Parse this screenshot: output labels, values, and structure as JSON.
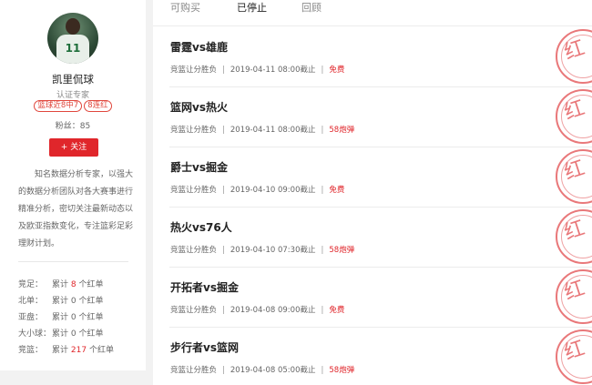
{
  "profile": {
    "avatar_number": "11",
    "name": "凯里侃球",
    "certification": "认证专家",
    "tags": [
      "篮球近8中7",
      "8连红"
    ],
    "fans_label": "粉丝：",
    "fans_count": "85",
    "follow_button": "+ 关注",
    "bio": "知名数据分析专家，以强大的数据分析团队对各大赛事进行精准分析，密切关注最新动态以及欧亚指数变化，专注篮彩足彩理财计划。",
    "stats": [
      {
        "label": "竞足：",
        "prefix": "累计",
        "count": "8",
        "suffix": "个红单",
        "highlight": true
      },
      {
        "label": "北单：",
        "prefix": "累计",
        "count": "0",
        "suffix": "个红单",
        "highlight": false
      },
      {
        "label": "亚盘：",
        "prefix": "累计",
        "count": "0",
        "suffix": "个红单",
        "highlight": false
      },
      {
        "label": "大小球：",
        "prefix": "累计",
        "count": "0",
        "suffix": "个红单",
        "highlight": false
      },
      {
        "label": "竞篮：",
        "prefix": "累计",
        "count": "217",
        "suffix": "个红单",
        "highlight": true
      }
    ]
  },
  "tabs": [
    {
      "label": "可购买",
      "active": false
    },
    {
      "label": "已停止",
      "active": true
    },
    {
      "label": "回顾",
      "active": false
    }
  ],
  "stamp_char": "红",
  "matches": [
    {
      "title": "雷霆vs雄鹿",
      "type": "竞篮让分胜负",
      "deadline": "2019-04-11 08:00截止",
      "price": "免费"
    },
    {
      "title": "篮网vs热火",
      "type": "竞篮让分胜负",
      "deadline": "2019-04-11 08:00截止",
      "price": "58炮弹"
    },
    {
      "title": "爵士vs掘金",
      "type": "竞篮让分胜负",
      "deadline": "2019-04-10 09:00截止",
      "price": "免费"
    },
    {
      "title": "热火vs76人",
      "type": "竞篮让分胜负",
      "deadline": "2019-04-10 07:30截止",
      "price": "58炮弹"
    },
    {
      "title": "开拓者vs掘金",
      "type": "竞篮让分胜负",
      "deadline": "2019-04-08 09:00截止",
      "price": "免费"
    },
    {
      "title": "步行者vs篮网",
      "type": "竞篮让分胜负",
      "deadline": "2019-04-08 05:00截止",
      "price": "58炮弹"
    }
  ],
  "colors": {
    "accent": "#e0262b",
    "stamp": "#e9787a"
  }
}
